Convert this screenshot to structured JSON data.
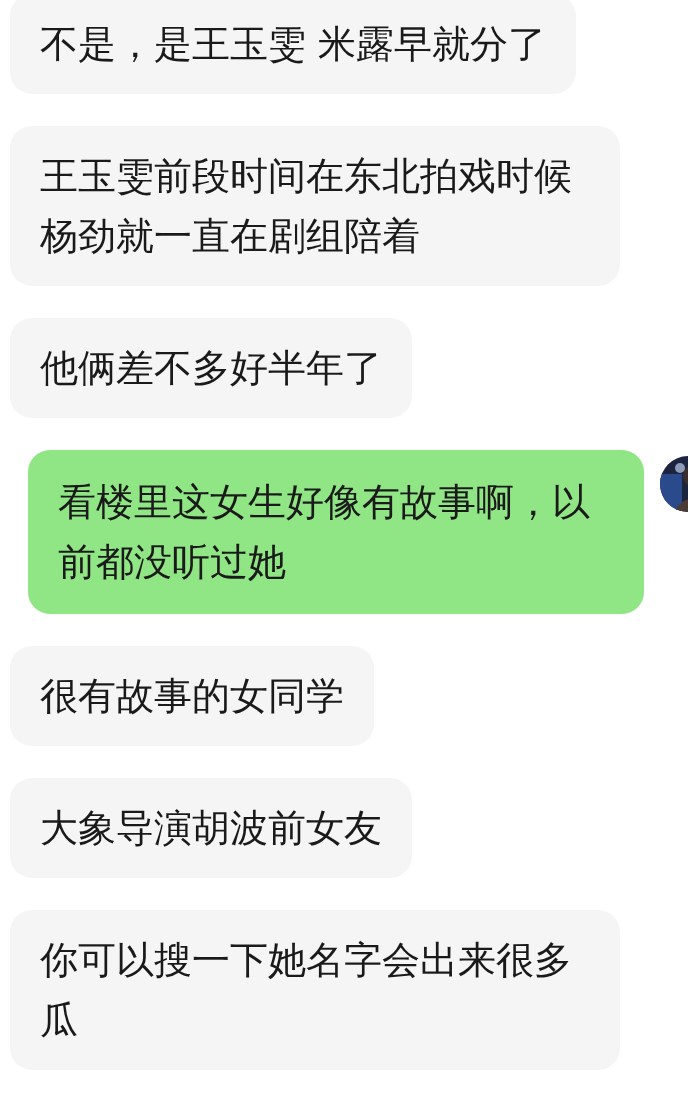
{
  "messages": [
    {
      "kind": "received",
      "text": "不是，是王玉雯 米露早就分了"
    },
    {
      "kind": "received",
      "text": "王玉雯前段时间在东北拍戏时候杨劲就一直在剧组陪着"
    },
    {
      "kind": "received",
      "text": "他俩差不多好半年了"
    },
    {
      "kind": "sent",
      "text": "看楼里这女生好像有故事啊，以前都没听过她"
    },
    {
      "kind": "received",
      "text": "很有故事的女同学"
    },
    {
      "kind": "received",
      "text": "大象导演胡波前女友"
    },
    {
      "kind": "received",
      "text": "你可以搜一下她名字会出来很多瓜"
    }
  ]
}
